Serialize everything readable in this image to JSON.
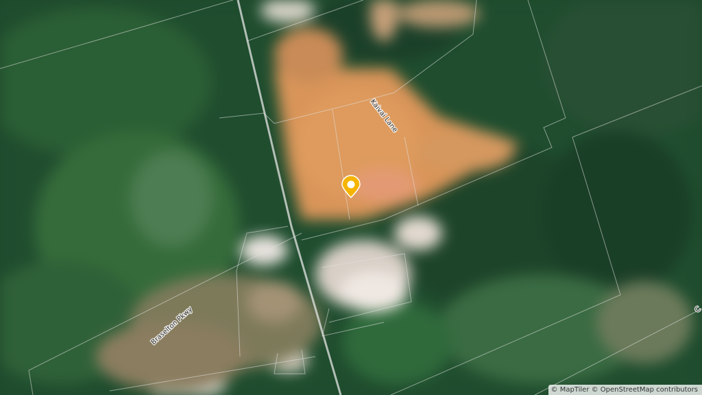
{
  "map": {
    "basemap": "satellite",
    "marker_color": "#f5b400",
    "road_labels": {
      "kaivai_lane": "Kaivai Lane",
      "braselton_pkwy": "Braselton Pkwy",
      "partial_right": "C"
    },
    "attribution": {
      "maptiler": "© MapTiler",
      "osm": "© OpenStreetMap contributors"
    }
  }
}
